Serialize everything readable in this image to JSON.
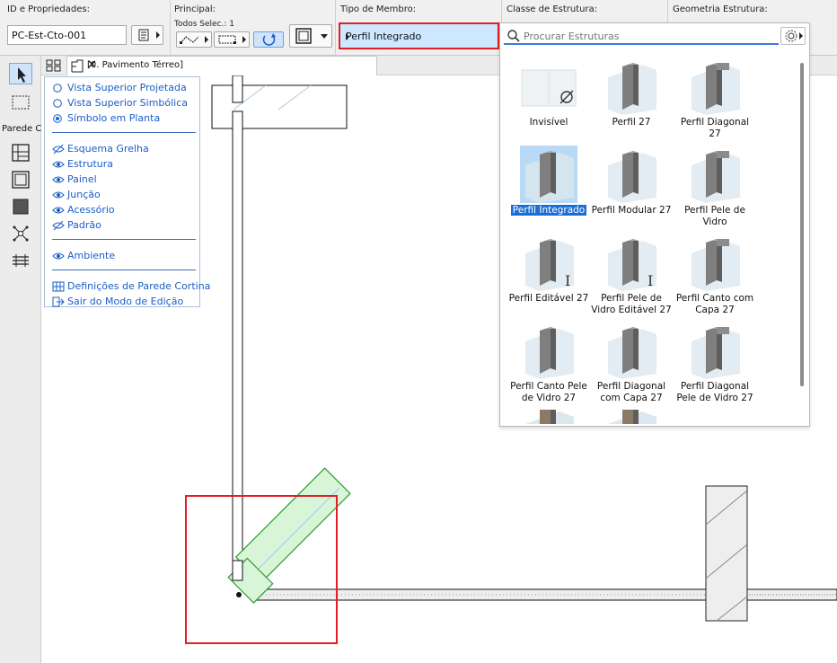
{
  "infobox": {
    "sections": {
      "id_title": "ID e Propriedades:",
      "principal_title": "Principal:",
      "member_title": "Tipo de Membro:",
      "class_title": "Classe de Estrutura:",
      "geometry_title": "Geometria Estrutura:"
    },
    "id_value": "PC-Est-Cto-001",
    "selection_text": "Todos Selec.: 1",
    "member_type_value": "Perfil Integrado"
  },
  "tab": {
    "title": "[0. Pavimento Térreo]",
    "close_glyph": "✕"
  },
  "toolbox": {
    "category_label": "Parede C"
  },
  "view_menu": {
    "items_a": [
      {
        "label": "Vista Superior Projetada",
        "icon": "radio-empty"
      },
      {
        "label": "Vista Superior Simbólica",
        "icon": "radio-empty"
      },
      {
        "label": "Símbolo em Planta",
        "icon": "radio-checked"
      }
    ],
    "items_b": [
      {
        "label": "Esquema Grelha",
        "icon": "eye-hidden"
      },
      {
        "label": "Estrutura",
        "icon": "eye"
      },
      {
        "label": "Painel",
        "icon": "eye"
      },
      {
        "label": "Junção",
        "icon": "eye"
      },
      {
        "label": "Acessório",
        "icon": "eye"
      },
      {
        "label": "Padrão",
        "icon": "eye-hidden"
      }
    ],
    "items_c": [
      {
        "label": "Ambiente",
        "icon": "eye"
      }
    ],
    "items_d": [
      {
        "label": "Definições de Parede Cortina",
        "icon": "grid-settings"
      },
      {
        "label": "Sair do Modo de Edição",
        "icon": "exit"
      }
    ]
  },
  "library": {
    "search_placeholder": "Procurar Estruturas",
    "tiles": [
      {
        "label": "Invisível",
        "icon": "empty-set",
        "selected": false
      },
      {
        "label": "Perfil 27",
        "icon": "profile-thumb",
        "selected": false
      },
      {
        "label": "Perfil Diagonal 27",
        "icon": "profile-thumb",
        "selected": false
      },
      {
        "label": "Perfil Integrado",
        "icon": "profile-thumb",
        "selected": true
      },
      {
        "label": "Perfil Modular 27",
        "icon": "profile-thumb",
        "selected": false
      },
      {
        "label": "Perfil Pele de Vidro",
        "icon": "profile-thumb",
        "selected": false
      },
      {
        "label": "Perfil Editável 27",
        "icon": "profile-thumb",
        "selected": false
      },
      {
        "label": "Perfil Pele de Vidro Editável 27",
        "icon": "profile-thumb",
        "selected": false
      },
      {
        "label": "Perfil Canto com Capa 27",
        "icon": "profile-thumb",
        "selected": false
      },
      {
        "label": "Perfil Canto Pele de Vidro 27",
        "icon": "profile-thumb",
        "selected": false
      },
      {
        "label": "Perfil Diagonal com Capa 27",
        "icon": "profile-thumb",
        "selected": false
      },
      {
        "label": "Perfil Diagonal Pele de Vidro 27",
        "icon": "profile-thumb",
        "selected": false
      }
    ]
  },
  "colors": {
    "accent_blue": "#1a6fd6",
    "highlight_red": "#e21f26",
    "selection_green": "#2f9b2f",
    "selected_fill": "#d8f5d8"
  }
}
